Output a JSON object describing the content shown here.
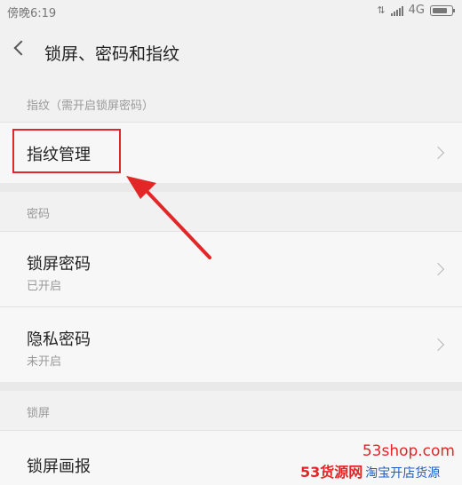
{
  "status_bar": {
    "time": "傍晚6:19",
    "network": "4G",
    "icons": [
      "data-arrows-icon",
      "signal-icon",
      "battery-icon"
    ]
  },
  "header": {
    "back_icon": "chevron-left-icon",
    "title": "锁屏、密码和指纹"
  },
  "sections": {
    "fingerprint": {
      "header": "指纹（需开启锁屏密码）",
      "items": [
        {
          "title": "指纹管理"
        }
      ]
    },
    "password": {
      "header": "密码",
      "items": [
        {
          "title": "锁屏密码",
          "subtitle": "已开启"
        },
        {
          "title": "隐私密码",
          "subtitle": "未开启"
        }
      ]
    },
    "lockscreen": {
      "header": "锁屏",
      "items": [
        {
          "title": "锁屏画报"
        }
      ]
    }
  },
  "annotation": {
    "highlight_color": "#e32626",
    "arrow_color": "#e32626"
  },
  "watermark": {
    "url": "53shop.com",
    "brand": "53货源网",
    "slogan": "淘宝开店货源"
  }
}
